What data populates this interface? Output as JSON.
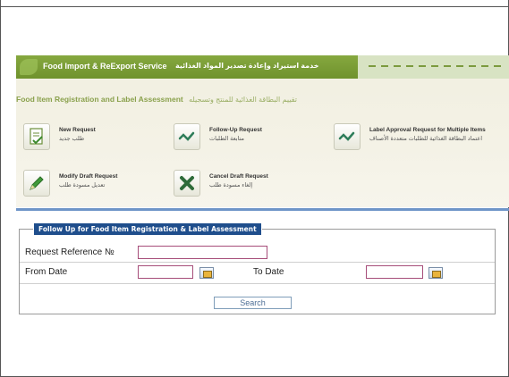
{
  "header": {
    "service_title_en": "Food Import & ReExport Service",
    "service_title_ar": "خدمة استيراد وإعادة تصدير المواد الغذائية",
    "subtitle_en": "Food Item Registration and Label Assessment",
    "subtitle_ar": "تقييم البطاقة الغذائية للمنتج وتسجيله"
  },
  "tiles": {
    "new_request": {
      "en": "New Request",
      "ar": "طلب جديد",
      "icon": "new-document-icon"
    },
    "follow_up": {
      "en": "Follow-Up Request",
      "ar": "متابعة الطلبات",
      "icon": "pen-check-icon"
    },
    "label_approval": {
      "en": "Label Approval Request for Multiple Items",
      "ar": "اعتماد البطاقة الغذائية للطلبات متعددة الأصناف",
      "icon": "pen-check-icon"
    },
    "modify_draft": {
      "en": "Modify Draft Request",
      "ar": "تعديل مسودة طلب",
      "icon": "pencil-icon"
    },
    "cancel_draft": {
      "en": "Cancel Draft Request",
      "ar": "إلغاء مسودة طلب",
      "icon": "cancel-x-icon"
    }
  },
  "form": {
    "legend": "Follow Up for Food Item Registration & Label Assessment",
    "request_ref_label": "Request Reference №",
    "request_ref_value": "",
    "from_date_label": "From Date",
    "from_date_value": "",
    "to_date_label": "To Date",
    "to_date_value": "",
    "search_label": "Search"
  },
  "colors": {
    "service_bar": "#7a9d35",
    "legend_bg": "#1f4e8c",
    "separator": "#6f95c8",
    "input_border": "#a64d79"
  }
}
